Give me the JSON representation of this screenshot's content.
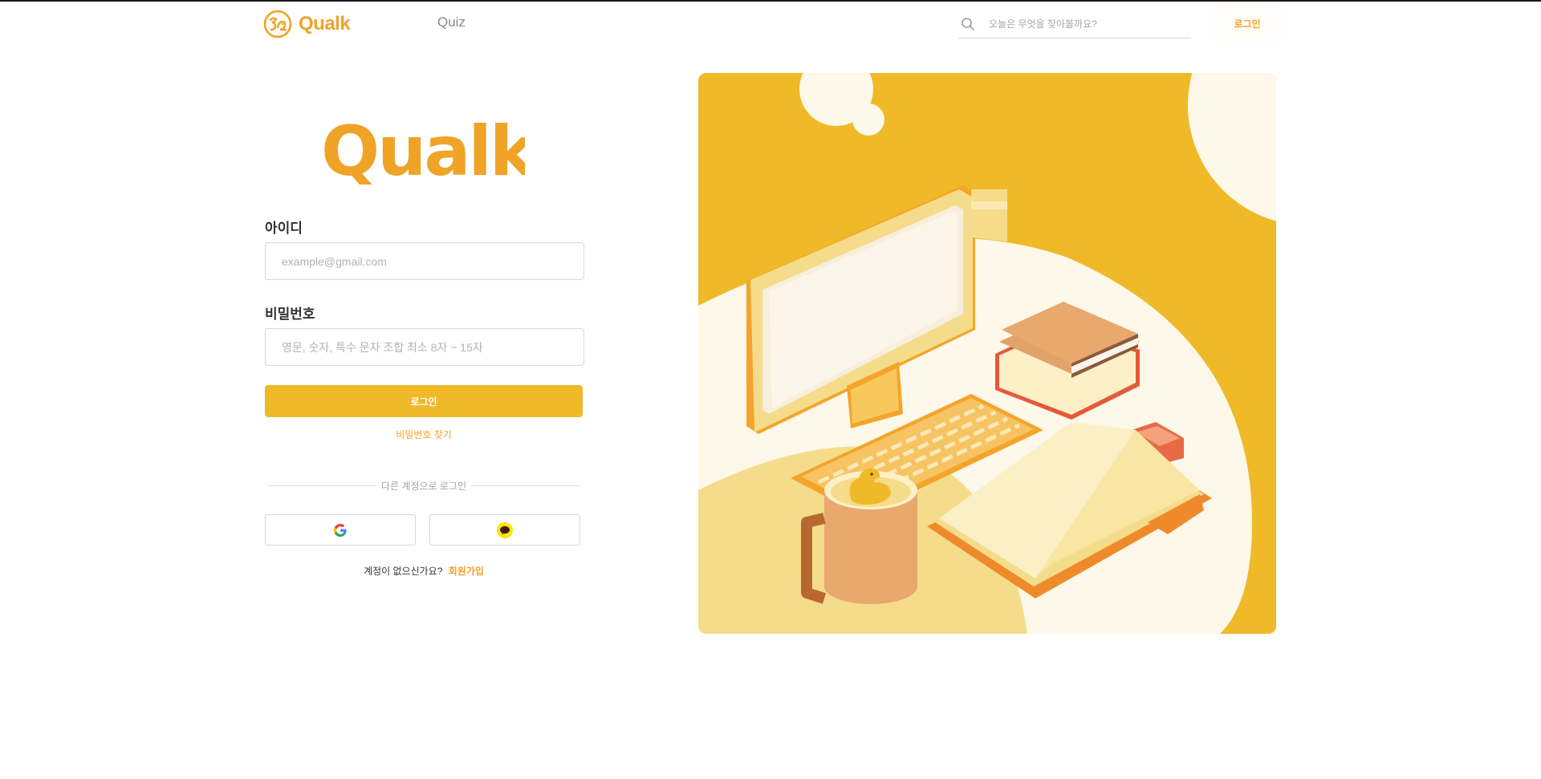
{
  "header": {
    "logo_text": "Qualk",
    "nav_quiz": "Quiz",
    "search_placeholder": "오늘은 무엇을 찾아볼까요?",
    "login_link": "로그인"
  },
  "form": {
    "brand": "Qualk",
    "id_label": "아이디",
    "id_placeholder": "example@gmail.com",
    "pw_label": "비밀번호",
    "pw_placeholder": "영문, 숫자, 특수 문자 조합 최소 8자 ~ 15자",
    "submit_label": "로그인",
    "find_password": "비밀번호 찾기",
    "divider_text": "다른 계정으로 로그인",
    "signup_prompt": "계정이 없으신가요?",
    "signup_link": "회원가입"
  },
  "social": {
    "google_icon": "google-icon",
    "kakao_icon": "kakao-icon"
  },
  "colors": {
    "brand": "#EFA327",
    "button": "#EFB928",
    "illustration_bg": "#EFB928",
    "cream": "#FDF8EA"
  }
}
